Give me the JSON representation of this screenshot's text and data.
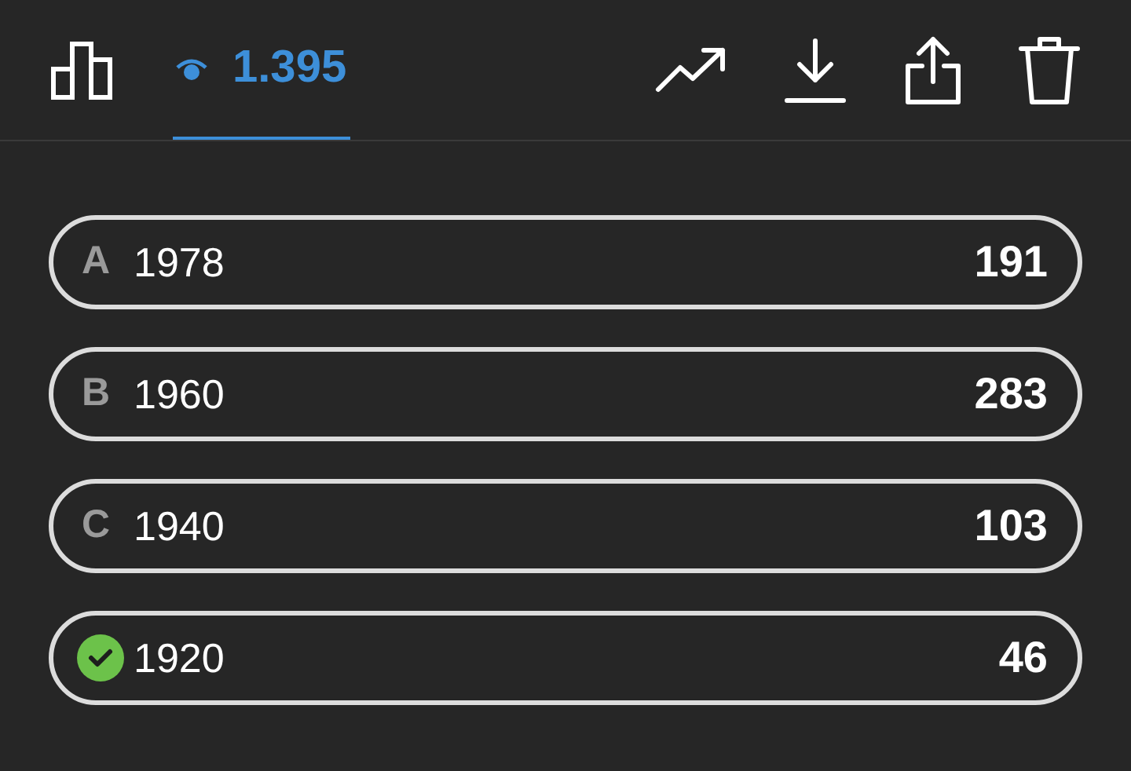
{
  "tabs": [
    {
      "kind": "chart",
      "selected": false
    },
    {
      "kind": "views",
      "label": "1.395",
      "selected": true
    }
  ],
  "options": [
    {
      "kind": "letter",
      "letter": "A",
      "label": "1978",
      "count": "191"
    },
    {
      "kind": "letter",
      "letter": "B",
      "label": "1960",
      "count": "283"
    },
    {
      "kind": "letter",
      "letter": "C",
      "label": "1940",
      "count": "103"
    },
    {
      "kind": "correct",
      "label": "1920",
      "count": "46"
    }
  ]
}
